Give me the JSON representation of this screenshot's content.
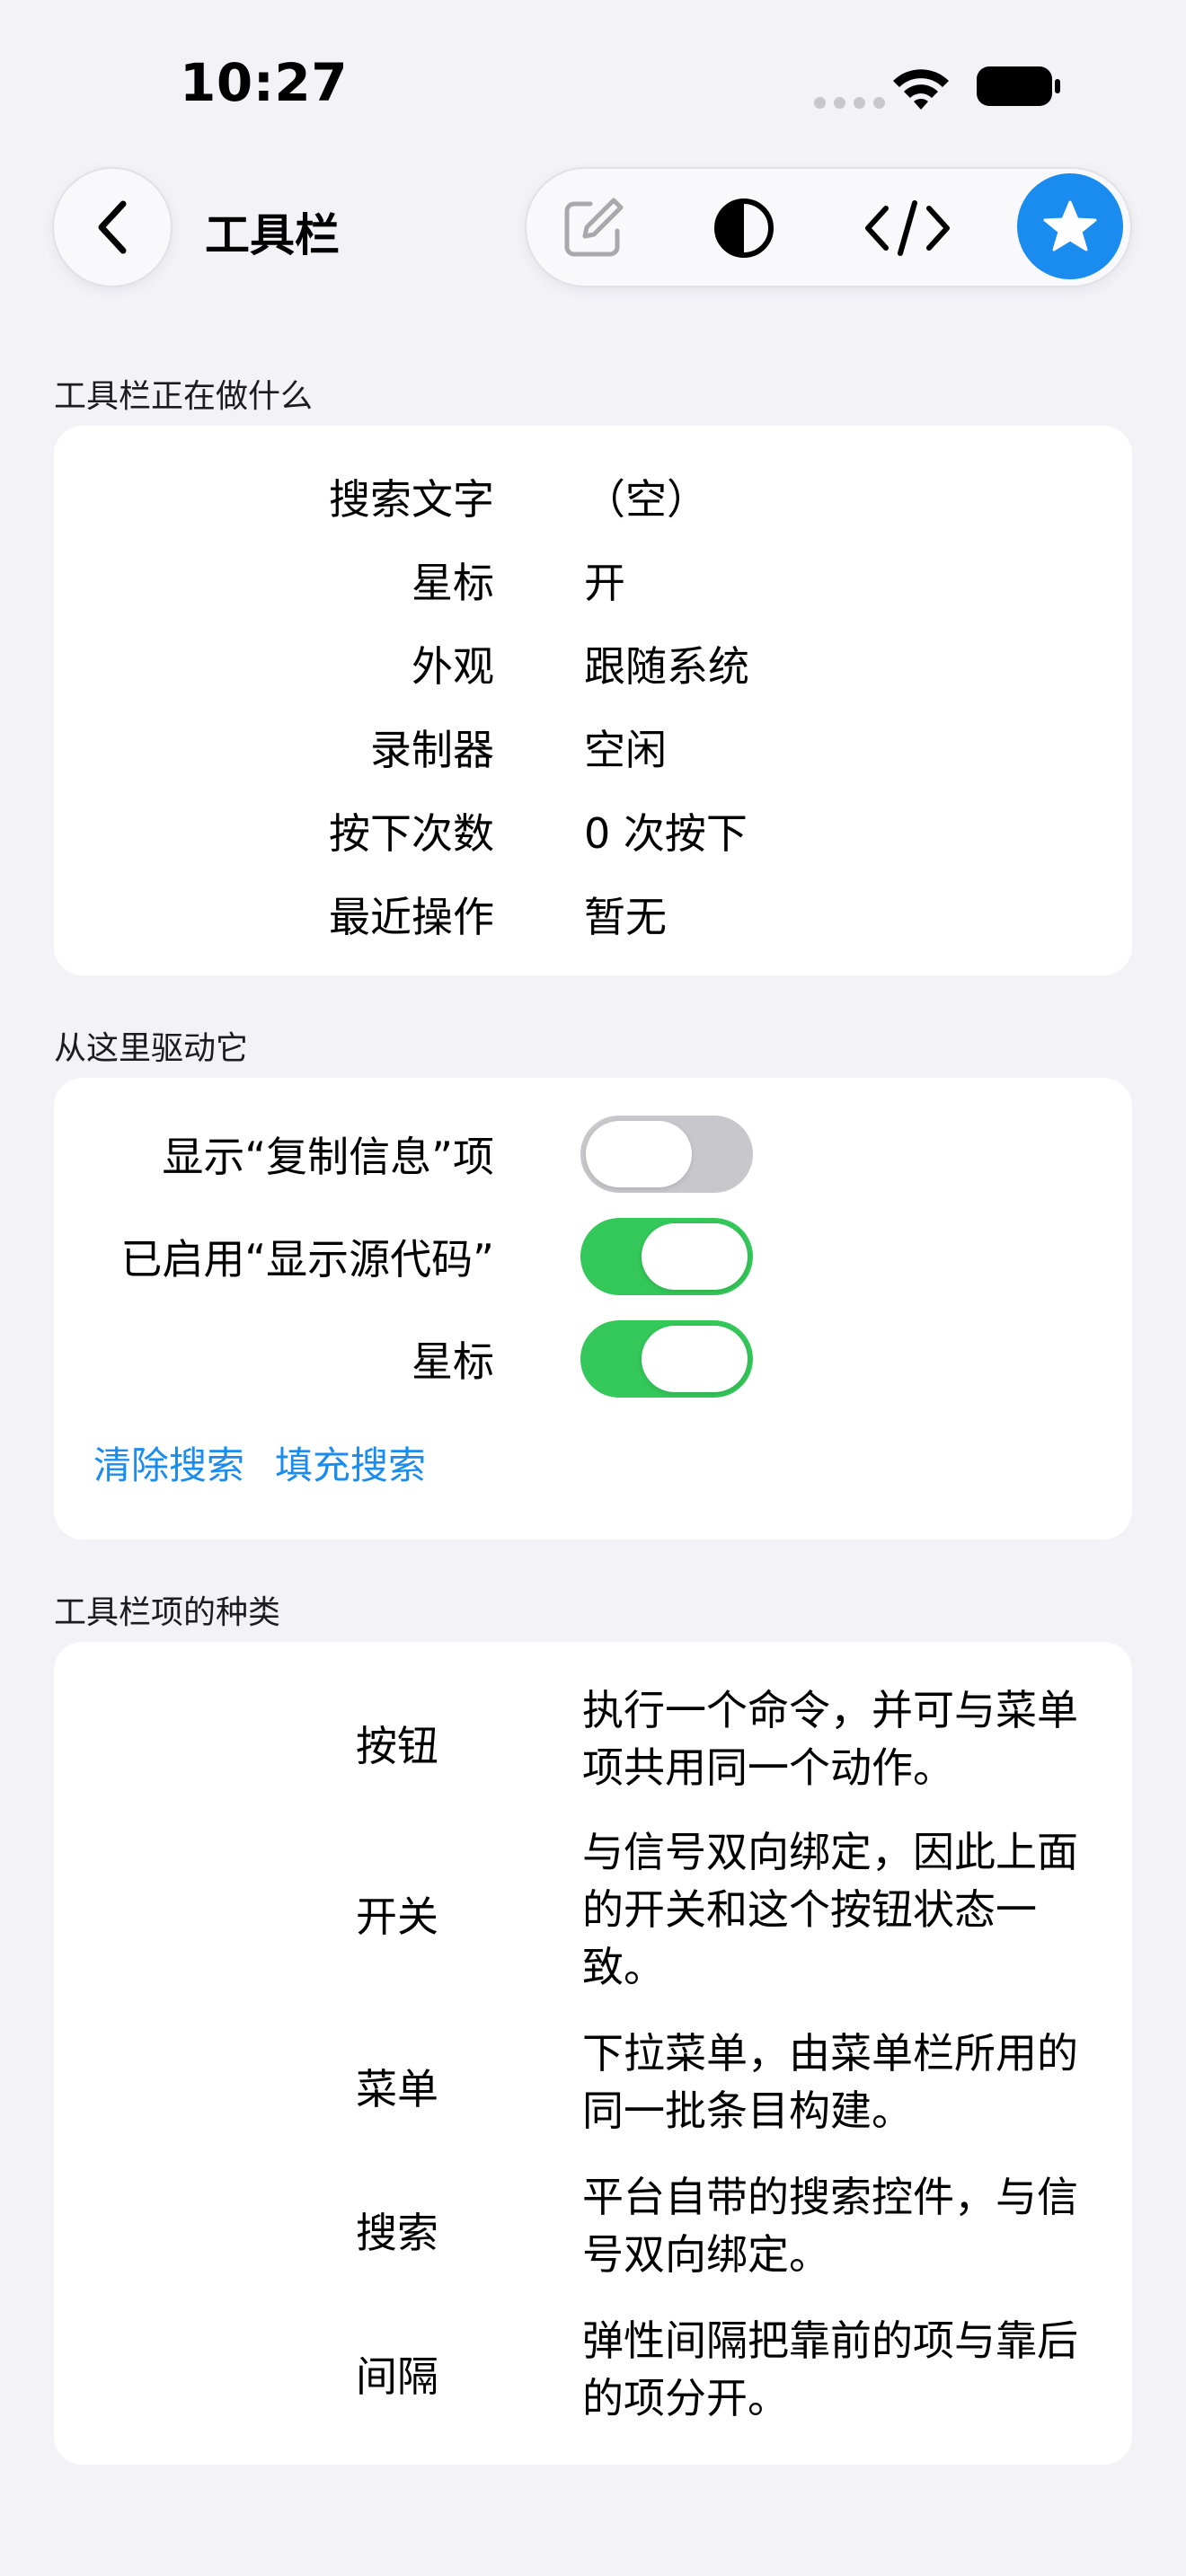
{
  "status_bar": {
    "time": "10:27"
  },
  "nav": {
    "back_icon": "chevron-left-icon",
    "title": "工具栏",
    "toolbar_icons": [
      "compose-icon",
      "contrast-icon",
      "code-icon",
      "star-icon"
    ],
    "accent_color": "#1a8cf0"
  },
  "section1": {
    "header": "工具栏正在做什么",
    "rows": [
      {
        "label": "搜索文字",
        "value": "（空）"
      },
      {
        "label": "星标",
        "value": "开"
      },
      {
        "label": "外观",
        "value": "跟随系统"
      },
      {
        "label": "录制器",
        "value": "空闲"
      },
      {
        "label": "按下次数",
        "value": "0 次按下"
      },
      {
        "label": "最近操作",
        "value": "暂无"
      }
    ]
  },
  "section2": {
    "header": "从这里驱动它",
    "toggles": [
      {
        "label": "显示“复制信息”项",
        "on": false
      },
      {
        "label": "已启用“显示源代码”",
        "on": true
      },
      {
        "label": "星标",
        "on": true
      }
    ],
    "links": [
      "清除搜索",
      "填充搜索"
    ],
    "toggle_on_color": "#34c759"
  },
  "section3": {
    "header": "工具栏项的种类",
    "rows": [
      {
        "label": "按钮",
        "lines": [
          "执行一个命令，并可与菜单",
          "项共用同一个动作。"
        ]
      },
      {
        "label": "开关",
        "lines": [
          "与信号双向绑定，因此上面",
          "的开关和这个按钮状态一",
          "致。"
        ]
      },
      {
        "label": "菜单",
        "lines": [
          "下拉菜单，由菜单栏所用的",
          "同一批条目构建。"
        ]
      },
      {
        "label": "搜索",
        "lines": [
          "平台自带的搜索控件，与信",
          "号双向绑定。"
        ]
      },
      {
        "label": "间隔",
        "lines": [
          "弹性间隔把靠前的项与靠后",
          "的项分开。"
        ]
      }
    ]
  }
}
